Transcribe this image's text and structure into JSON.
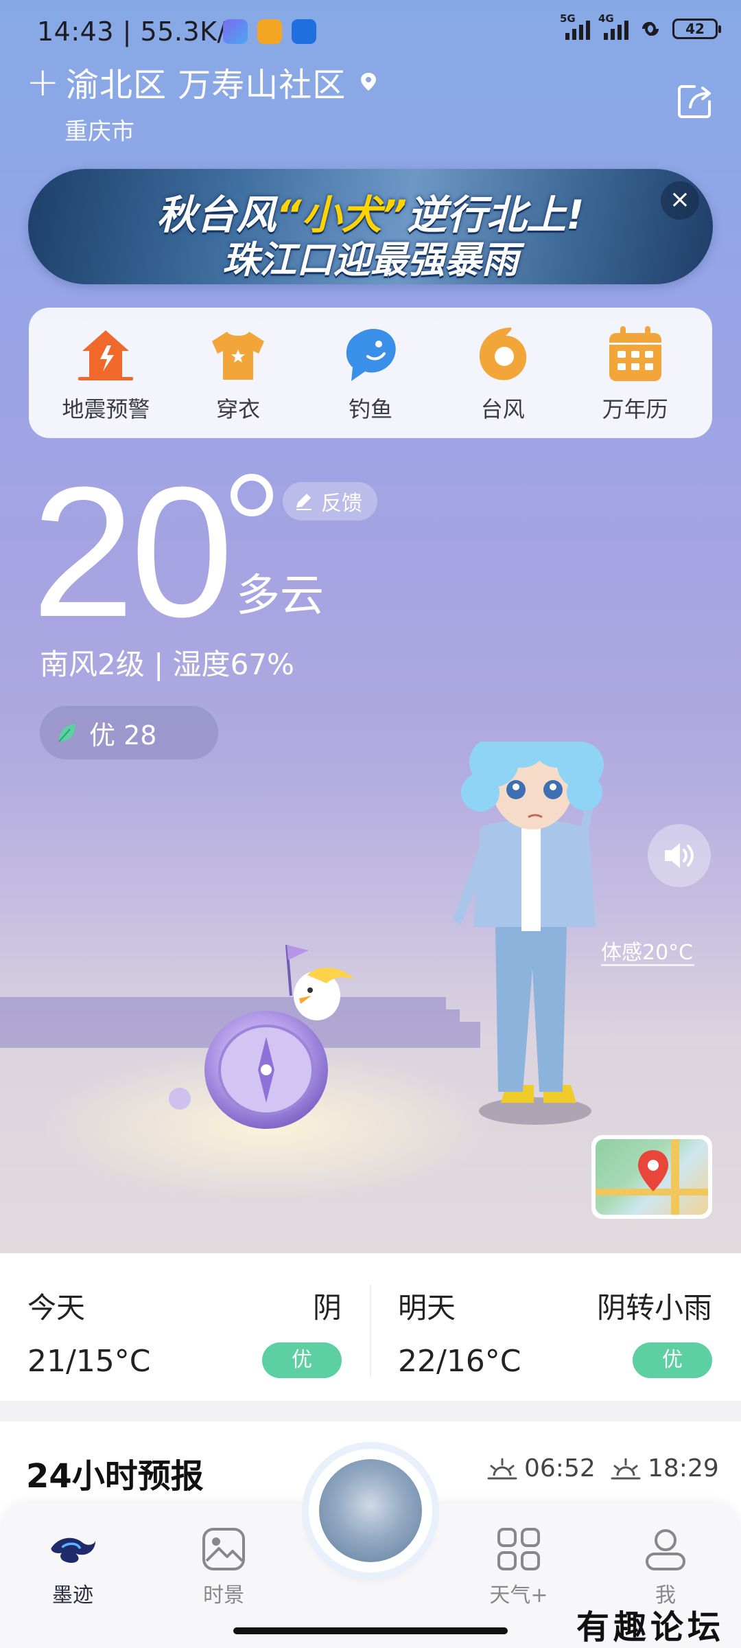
{
  "status_bar": {
    "time": "14:43",
    "separator": "|",
    "speed": "55.3K/s",
    "sim1": "5G",
    "sim2": "4G",
    "battery": "42"
  },
  "location": {
    "district": "渝北区 万寿山社区",
    "city": "重庆市"
  },
  "banner": {
    "line1_prefix": "秋台风",
    "line1_highlight": "“小犬”",
    "line1_suffix": "逆行北上!",
    "line2": "珠江口迎最强暴雨",
    "close": "×"
  },
  "tools": [
    {
      "label": "地震预警",
      "icon": "earthquake-icon",
      "color": "#f0692b"
    },
    {
      "label": "穿衣",
      "icon": "tshirt-icon",
      "color": "#f2a63a"
    },
    {
      "label": "钓鱼",
      "icon": "fish-icon",
      "color": "#3a8fe8"
    },
    {
      "label": "台风",
      "icon": "typhoon-icon",
      "color": "#f2a63a"
    },
    {
      "label": "万年历",
      "icon": "calendar-icon",
      "color": "#f2a63a"
    }
  ],
  "current": {
    "temperature": "20",
    "condition": "多云",
    "wind_humidity": "南风2级 | 湿度67%",
    "aqi": "优 28",
    "feedback": "反馈",
    "feels_like": "体感20°C"
  },
  "forecast": [
    {
      "day": "今天",
      "condition": "阴",
      "temp": "21/15°C",
      "aqi": "优"
    },
    {
      "day": "明天",
      "condition": "阴转小雨",
      "temp": "22/16°C",
      "aqi": "优"
    }
  ],
  "hourly": {
    "title": "24小时预报",
    "sunrise": "06:52",
    "sunset": "18:29"
  },
  "nav": [
    {
      "label": "墨迹",
      "icon": "moji-logo-icon",
      "active": true
    },
    {
      "label": "时景",
      "icon": "gallery-icon",
      "active": false
    },
    {
      "label": "天气+",
      "icon": "grid-icon",
      "active": false
    },
    {
      "label": "我",
      "icon": "profile-icon",
      "active": false
    }
  ],
  "watermark": "有趣论坛"
}
